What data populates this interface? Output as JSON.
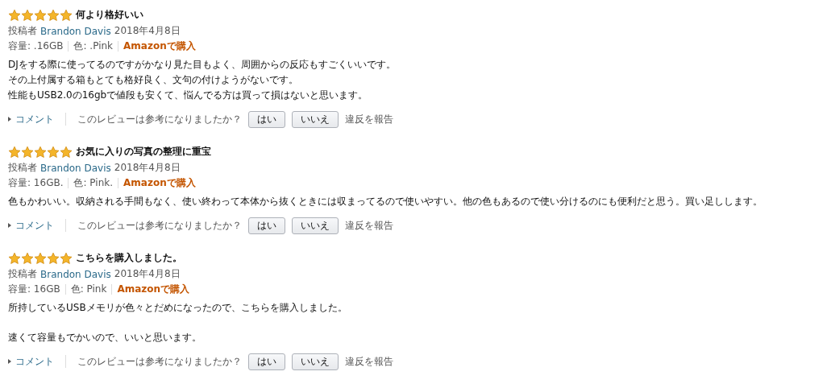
{
  "reviews": [
    {
      "stars": 5,
      "title": "何より格好いい",
      "author_label": "投稿者",
      "author": "Brandon Davis",
      "date": "2018年4月8日",
      "meta": [
        "容量: .16GB",
        "色: .Pink"
      ],
      "purchase": "Amazonで購入",
      "body": [
        [
          "DJをする際に使ってるのですがかなり見た目もよく、周囲からの反応もすごくいいです。",
          "その上付属する箱もとても格好良く、文句の付けようがないです。",
          "性能もUSB2.0の16gbで値段も安くて、悩んでる方は買って損はないと思います。"
        ]
      ],
      "comment": "コメント",
      "helpful": "このレビューは参考になりましたか？",
      "yes": "はい",
      "no": "いいえ",
      "report": "違反を報告"
    },
    {
      "stars": 5,
      "title": "お気に入りの写真の整理に重宝",
      "author_label": "投稿者",
      "author": "Brandon Davis",
      "date": "2018年4月8日",
      "meta": [
        "容量: 16GB.",
        "色: Pink."
      ],
      "purchase": "Amazonで購入",
      "body": [
        [
          "色もかわいい。収納される手間もなく、使い終わって本体から抜くときには収まってるので使いやすい。他の色もあるので使い分けるのにも便利だと思う。買い足しします。"
        ]
      ],
      "comment": "コメント",
      "helpful": "このレビューは参考になりましたか？",
      "yes": "はい",
      "no": "いいえ",
      "report": "違反を報告"
    },
    {
      "stars": 5,
      "title": "こちらを購入しました。",
      "author_label": "投稿者",
      "author": "Brandon Davis",
      "date": "2018年4月8日",
      "meta": [
        "容量: 16GB",
        "色: Pink"
      ],
      "purchase": "Amazonで購入",
      "body": [
        [
          "所持しているUSBメモリが色々とだめになったので、こちらを購入しました。"
        ],
        [
          "速くて容量もでかいので、いいと思います。"
        ]
      ],
      "comment": "コメント",
      "helpful": "このレビューは参考になりましたか？",
      "yes": "はい",
      "no": "いいえ",
      "report": "違反を報告"
    }
  ]
}
